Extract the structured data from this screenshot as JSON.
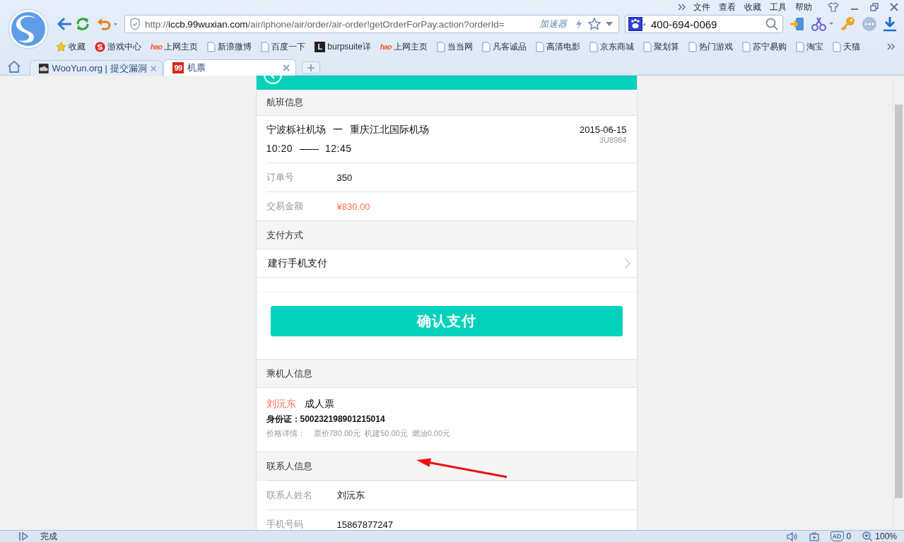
{
  "window": {
    "menu": [
      "文件",
      "查看",
      "收藏",
      "工具",
      "帮助"
    ]
  },
  "toolbar": {
    "address": {
      "scheme": "http://",
      "host": "iccb.99wuxian.com",
      "path": "/air/iphone/air/order/air-order!getOrderForPay.action?orderId="
    },
    "accelerator": "加速器",
    "search": {
      "value": "400-694-0069"
    }
  },
  "bookmarks": [
    {
      "label": "收藏",
      "kind": "star"
    },
    {
      "label": "游戏中心",
      "kind": "game"
    },
    {
      "label": "上网主页",
      "kind": "hao",
      "icon_text": "hao"
    },
    {
      "label": "新浪微博",
      "kind": "page"
    },
    {
      "label": "百度一下",
      "kind": "page"
    },
    {
      "label": "burpsuite详",
      "kind": "app",
      "icon_text": "L"
    },
    {
      "label": "上网主页",
      "kind": "hao",
      "icon_text": "hao"
    },
    {
      "label": "当当网",
      "kind": "page"
    },
    {
      "label": "凡客诚品",
      "kind": "page"
    },
    {
      "label": "高清电影",
      "kind": "page"
    },
    {
      "label": "京东商城",
      "kind": "page"
    },
    {
      "label": "聚划算",
      "kind": "page"
    },
    {
      "label": "热门游戏",
      "kind": "page"
    },
    {
      "label": "苏宁易购",
      "kind": "page"
    },
    {
      "label": "淘宝",
      "kind": "page"
    },
    {
      "label": "天猫",
      "kind": "page"
    }
  ],
  "tabs": [
    {
      "label": "WooYun.org | 提交漏洞",
      "selected": false,
      "kind": "image"
    },
    {
      "label": "机票",
      "selected": true,
      "kind": "logo",
      "logo_text": "99"
    }
  ],
  "page": {
    "sections": [
      {
        "kind": "header",
        "title": "航班信息"
      },
      {
        "kind": "flight",
        "origin": "宁波栎社机场",
        "route_separator": "一",
        "destination": "重庆江北国际机场",
        "departure": "10:20",
        "time_separator": "——",
        "arrival": "12:45",
        "date": "2015-06-15",
        "flight_no": "3U8984"
      },
      {
        "kind": "row",
        "label": "订单号",
        "value": "350",
        "highlight": false
      },
      {
        "kind": "row",
        "label": "交易金额",
        "value": "¥830.00",
        "highlight": true
      },
      {
        "kind": "header",
        "title": "支付方式"
      },
      {
        "kind": "link",
        "label": "建行手机支付"
      },
      {
        "kind": "action",
        "label": "确认支付"
      },
      {
        "kind": "header",
        "title": "乘机人信息"
      },
      {
        "kind": "passenger",
        "name": "刘沅东",
        "ticket_type": "成人票",
        "id_label": "身份证：",
        "id_number": "500232198901215014",
        "price_label": "价格详情：",
        "prices": [
          "票价780.00元",
          "机建50.00元",
          "燃油0.00元"
        ]
      },
      {
        "kind": "header",
        "title": "联系人信息"
      },
      {
        "kind": "row",
        "label": "联系人姓名",
        "value": "刘沅东",
        "highlight": false
      },
      {
        "kind": "row",
        "label": "手机号码",
        "value": "15867877247",
        "highlight": false
      }
    ],
    "annotations": [
      {
        "kind": "arrow"
      }
    ]
  },
  "status_bar": {
    "text": "完成",
    "ad_badge": "AD",
    "ad_count": "0",
    "zoom": "100%"
  }
}
